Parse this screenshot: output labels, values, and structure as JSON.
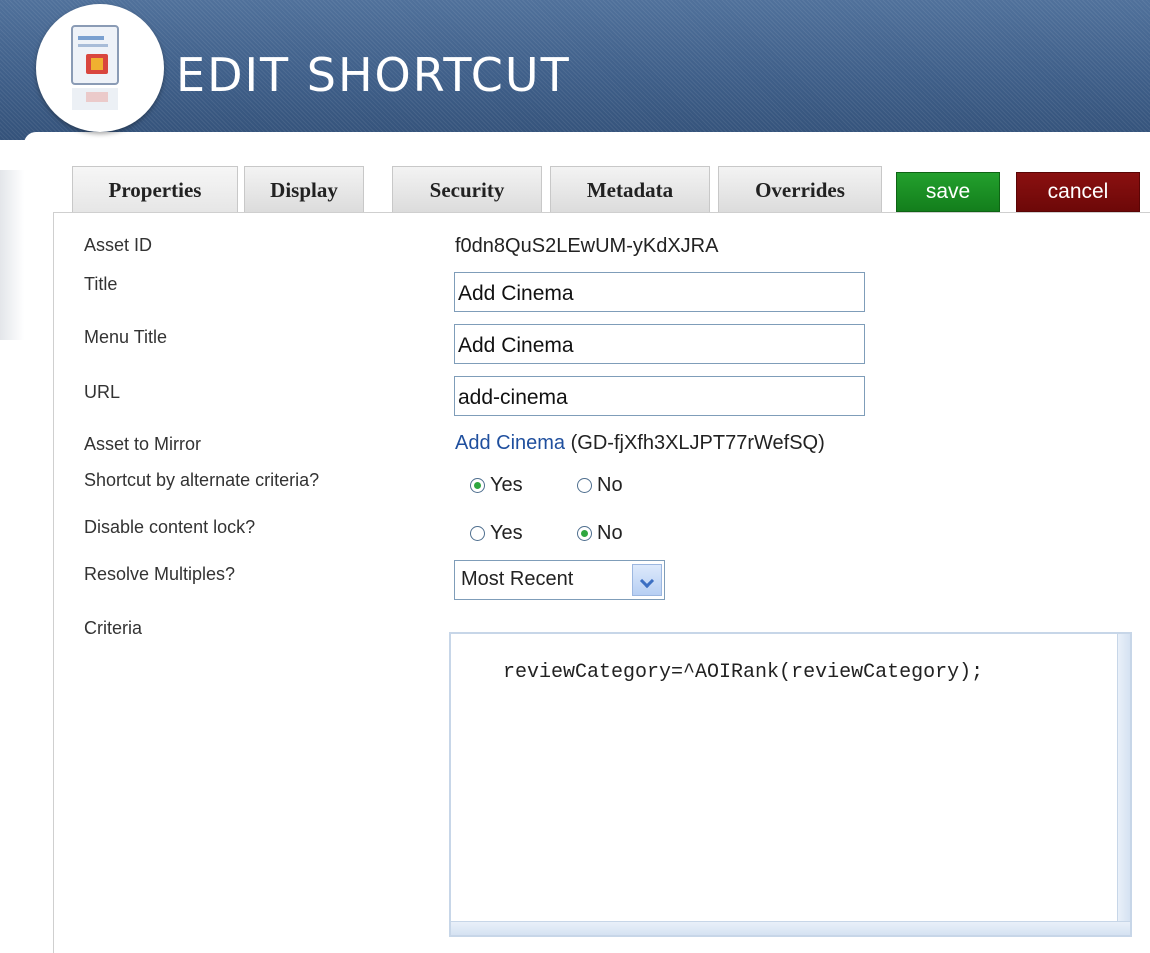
{
  "header": {
    "title": "EDIT SHORTCUT"
  },
  "tabs": [
    "Properties",
    "Display",
    "Security",
    "Metadata",
    "Overrides"
  ],
  "buttons": {
    "save": "save",
    "cancel": "cancel"
  },
  "form": {
    "asset_id": {
      "label": "Asset ID",
      "value": "f0dn8QuS2LEwUM-yKdXJRA"
    },
    "title": {
      "label": "Title",
      "value": "Add Cinema"
    },
    "menu_title": {
      "label": "Menu Title",
      "value": "Add Cinema"
    },
    "url": {
      "label": "URL",
      "value": "add-cinema"
    },
    "asset_to_mirror": {
      "label": "Asset to Mirror",
      "link": "Add Cinema",
      "id": "(GD-fjXfh3XLJPT77rWefSQ)"
    },
    "shortcut_by_alternate_criteria": {
      "label": "Shortcut by alternate criteria?",
      "options": [
        "Yes",
        "No"
      ],
      "selected": "Yes"
    },
    "disable_content_lock": {
      "label": "Disable content lock?",
      "options": [
        "Yes",
        "No"
      ],
      "selected": "No"
    },
    "resolve_multiples": {
      "label": "Resolve Multiples?",
      "value": "Most Recent"
    },
    "criteria": {
      "label": "Criteria",
      "value": "reviewCategory=^AOIRank(reviewCategory);"
    }
  },
  "colors": {
    "header": "#3f5f89",
    "save": "#1a8f24",
    "cancel": "#7a0c0c",
    "link": "#1f4f9e"
  },
  "icons": {
    "logo": "document-icon",
    "dropdown": "chevron-down-icon"
  }
}
